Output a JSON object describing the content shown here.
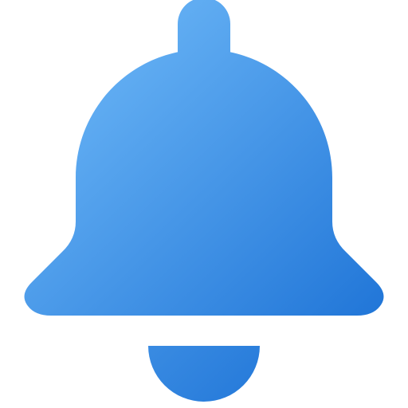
{
  "icon": {
    "name": "bell-icon",
    "gradient_start": "#6ab5f6",
    "gradient_end": "#1a70d5"
  }
}
